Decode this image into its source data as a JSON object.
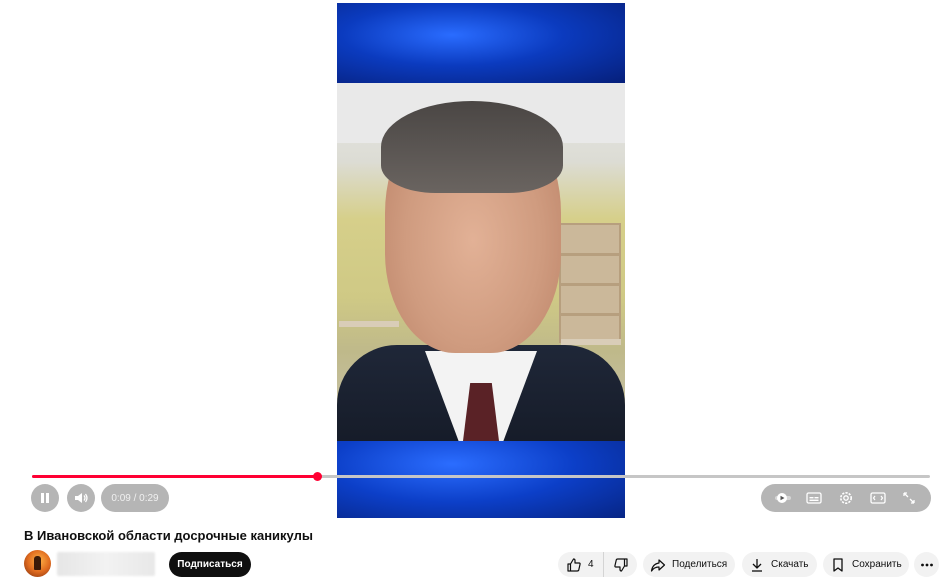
{
  "player": {
    "time_display": "0:09 / 0:29",
    "progress_fraction": 0.317,
    "accent_color": "#ff0033"
  },
  "video": {
    "title": "В Ивановской области досрочные каникулы"
  },
  "channel": {
    "subscribe_label": "Подписаться"
  },
  "actions": {
    "like_count": "4",
    "share_label": "Поделиться",
    "download_label": "Скачать",
    "save_label": "Сохранить"
  },
  "icons": {
    "pause": "pause-icon",
    "volume": "volume-icon",
    "autoplay": "autoplay-icon",
    "subtitles": "subtitles-icon",
    "settings": "settings-gear-icon",
    "theater": "theater-mode-icon",
    "fullscreen": "fullscreen-icon",
    "like": "thumbs-up-icon",
    "dislike": "thumbs-down-icon",
    "share": "share-arrow-icon",
    "download": "download-icon",
    "save": "bookmark-icon",
    "more": "more-horizontal-icon"
  }
}
